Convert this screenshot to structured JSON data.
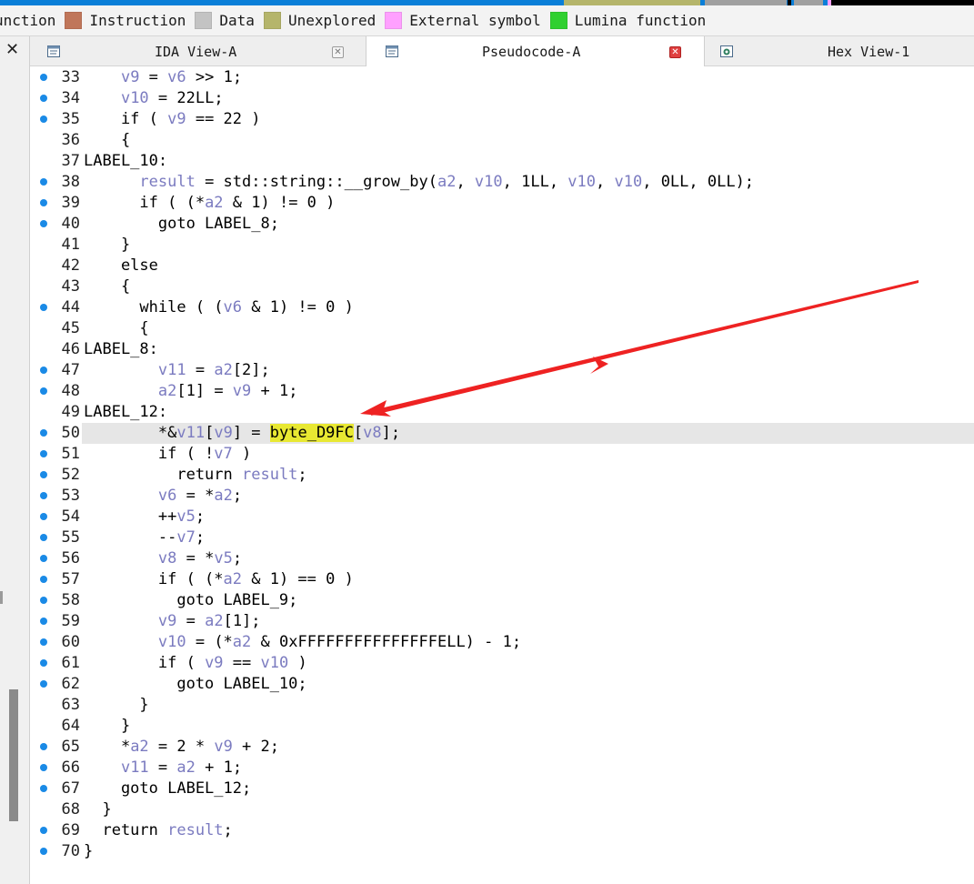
{
  "legend": {
    "items": [
      {
        "label": "unction",
        "color": null
      },
      {
        "label": "Instruction",
        "color": "#c0765a"
      },
      {
        "label": "Data",
        "color": "#c3c3c3"
      },
      {
        "label": "Unexplored",
        "color": "#b5b56b"
      },
      {
        "label": "External symbol",
        "color": "#ffa0ff"
      },
      {
        "label": "Lumina function",
        "color": "#30d030"
      }
    ]
  },
  "tabs": {
    "ida": {
      "label": "IDA View-A",
      "icon": "ida-view-icon"
    },
    "pseudo": {
      "label": "Pseudocode-A",
      "icon": "pseudocode-icon"
    },
    "hex": {
      "label": "Hex View-1",
      "icon": "hex-view-icon"
    }
  },
  "left_panel": {
    "close_label": "✕"
  },
  "code": {
    "lines": [
      {
        "n": "33",
        "dot": true
      },
      {
        "n": "34",
        "dot": true
      },
      {
        "n": "35",
        "dot": true
      },
      {
        "n": "36",
        "dot": false
      },
      {
        "n": "37",
        "dot": false
      },
      {
        "n": "38",
        "dot": true
      },
      {
        "n": "39",
        "dot": true
      },
      {
        "n": "40",
        "dot": true
      },
      {
        "n": "41",
        "dot": false
      },
      {
        "n": "42",
        "dot": false
      },
      {
        "n": "43",
        "dot": false
      },
      {
        "n": "44",
        "dot": true
      },
      {
        "n": "45",
        "dot": false
      },
      {
        "n": "46",
        "dot": false
      },
      {
        "n": "47",
        "dot": true
      },
      {
        "n": "48",
        "dot": true
      },
      {
        "n": "49",
        "dot": false
      },
      {
        "n": "50",
        "dot": true
      },
      {
        "n": "51",
        "dot": true
      },
      {
        "n": "52",
        "dot": true
      },
      {
        "n": "53",
        "dot": true
      },
      {
        "n": "54",
        "dot": true
      },
      {
        "n": "55",
        "dot": true
      },
      {
        "n": "56",
        "dot": true
      },
      {
        "n": "57",
        "dot": true
      },
      {
        "n": "58",
        "dot": true
      },
      {
        "n": "59",
        "dot": true
      },
      {
        "n": "60",
        "dot": true
      },
      {
        "n": "61",
        "dot": true
      },
      {
        "n": "62",
        "dot": true
      },
      {
        "n": "63",
        "dot": false
      },
      {
        "n": "64",
        "dot": false
      },
      {
        "n": "65",
        "dot": true
      },
      {
        "n": "66",
        "dot": true
      },
      {
        "n": "67",
        "dot": true
      },
      {
        "n": "68",
        "dot": false
      },
      {
        "n": "69",
        "dot": true
      },
      {
        "n": "70",
        "dot": true
      }
    ],
    "text": [
      [
        [
          "    ",
          ""
        ],
        [
          "v9",
          "g"
        ],
        [
          " = ",
          ""
        ],
        [
          "v6",
          "g"
        ],
        [
          " >> 1;",
          ""
        ]
      ],
      [
        [
          "    ",
          ""
        ],
        [
          "v10",
          "g"
        ],
        [
          " = 22LL;",
          ""
        ]
      ],
      [
        [
          "    if ( ",
          ""
        ],
        [
          "v9",
          "g"
        ],
        [
          " == 22 )",
          ""
        ]
      ],
      [
        [
          "    {",
          ""
        ]
      ],
      [
        [
          "LABEL_10:",
          ""
        ]
      ],
      [
        [
          "      ",
          ""
        ],
        [
          "result",
          "g"
        ],
        [
          " = std::string::__grow_by(",
          ""
        ],
        [
          "a2",
          "g"
        ],
        [
          ", ",
          ""
        ],
        [
          "v10",
          "g"
        ],
        [
          ", 1LL, ",
          ""
        ],
        [
          "v10",
          "g"
        ],
        [
          ", ",
          ""
        ],
        [
          "v10",
          "g"
        ],
        [
          ", 0LL, 0LL);",
          ""
        ]
      ],
      [
        [
          "      if ( (*",
          ""
        ],
        [
          "a2",
          "g"
        ],
        [
          " & 1) != 0 )",
          ""
        ]
      ],
      [
        [
          "        goto LABEL_8;",
          ""
        ]
      ],
      [
        [
          "    }",
          ""
        ]
      ],
      [
        [
          "    else",
          ""
        ]
      ],
      [
        [
          "    {",
          ""
        ]
      ],
      [
        [
          "      while ( (",
          ""
        ],
        [
          "v6",
          "g"
        ],
        [
          " & 1) != 0 )",
          ""
        ]
      ],
      [
        [
          "      {",
          ""
        ]
      ],
      [
        [
          "LABEL_8:",
          ""
        ]
      ],
      [
        [
          "        ",
          ""
        ],
        [
          "v11",
          "g"
        ],
        [
          " = ",
          ""
        ],
        [
          "a2",
          "g"
        ],
        [
          "[2];",
          ""
        ]
      ],
      [
        [
          "        ",
          ""
        ],
        [
          "a2",
          "g"
        ],
        [
          "[1] = ",
          ""
        ],
        [
          "v9",
          "g"
        ],
        [
          " + 1;",
          ""
        ]
      ],
      [
        [
          "LABEL_12:",
          ""
        ]
      ],
      [
        [
          "        *&",
          ""
        ],
        [
          "v11",
          "g"
        ],
        [
          "[",
          ""
        ],
        [
          "v9",
          "g"
        ],
        [
          "] = ",
          ""
        ],
        [
          "byte_D9FC",
          "yel"
        ],
        [
          "[",
          ""
        ],
        [
          "v8",
          "g"
        ],
        [
          "];",
          ""
        ]
      ],
      [
        [
          "        if ( !",
          ""
        ],
        [
          "v7",
          "g"
        ],
        [
          " )",
          ""
        ]
      ],
      [
        [
          "          return ",
          ""
        ],
        [
          "result",
          "g"
        ],
        [
          ";",
          ""
        ]
      ],
      [
        [
          "        ",
          ""
        ],
        [
          "v6",
          "g"
        ],
        [
          " = *",
          ""
        ],
        [
          "a2",
          "g"
        ],
        [
          ";",
          ""
        ]
      ],
      [
        [
          "        ++",
          ""
        ],
        [
          "v5",
          "g"
        ],
        [
          ";",
          ""
        ]
      ],
      [
        [
          "        --",
          ""
        ],
        [
          "v7",
          "g"
        ],
        [
          ";",
          ""
        ]
      ],
      [
        [
          "        ",
          ""
        ],
        [
          "v8",
          "g"
        ],
        [
          " = *",
          ""
        ],
        [
          "v5",
          "g"
        ],
        [
          ";",
          ""
        ]
      ],
      [
        [
          "        if ( (*",
          ""
        ],
        [
          "a2",
          "g"
        ],
        [
          " & 1) == 0 )",
          ""
        ]
      ],
      [
        [
          "          goto LABEL_9;",
          ""
        ]
      ],
      [
        [
          "        ",
          ""
        ],
        [
          "v9",
          "g"
        ],
        [
          " = ",
          ""
        ],
        [
          "a2",
          "g"
        ],
        [
          "[1];",
          ""
        ]
      ],
      [
        [
          "        ",
          ""
        ],
        [
          "v10",
          "g"
        ],
        [
          " = (*",
          ""
        ],
        [
          "a2",
          "g"
        ],
        [
          " & 0xFFFFFFFFFFFFFFFELL) - 1;",
          ""
        ]
      ],
      [
        [
          "        if ( ",
          ""
        ],
        [
          "v9",
          "g"
        ],
        [
          " == ",
          ""
        ],
        [
          "v10",
          "g"
        ],
        [
          " )",
          ""
        ]
      ],
      [
        [
          "          goto LABEL_10;",
          ""
        ]
      ],
      [
        [
          "      }",
          ""
        ]
      ],
      [
        [
          "    }",
          ""
        ]
      ],
      [
        [
          "    *",
          ""
        ],
        [
          "a2",
          "g"
        ],
        [
          " = 2 * ",
          ""
        ],
        [
          "v9",
          "g"
        ],
        [
          " + 2;",
          ""
        ]
      ],
      [
        [
          "    ",
          ""
        ],
        [
          "v11",
          "g"
        ],
        [
          " = ",
          ""
        ],
        [
          "a2",
          "g"
        ],
        [
          " + 1;",
          ""
        ]
      ],
      [
        [
          "    goto LABEL_12;",
          ""
        ]
      ],
      [
        [
          "  }",
          ""
        ]
      ],
      [
        [
          "  return ",
          ""
        ],
        [
          "result",
          "g"
        ],
        [
          ";",
          ""
        ]
      ],
      [
        [
          "}",
          ""
        ]
      ]
    ],
    "highlighted_line": "50"
  },
  "annotation": {
    "type": "red-arrow",
    "color": "#ee2222"
  }
}
